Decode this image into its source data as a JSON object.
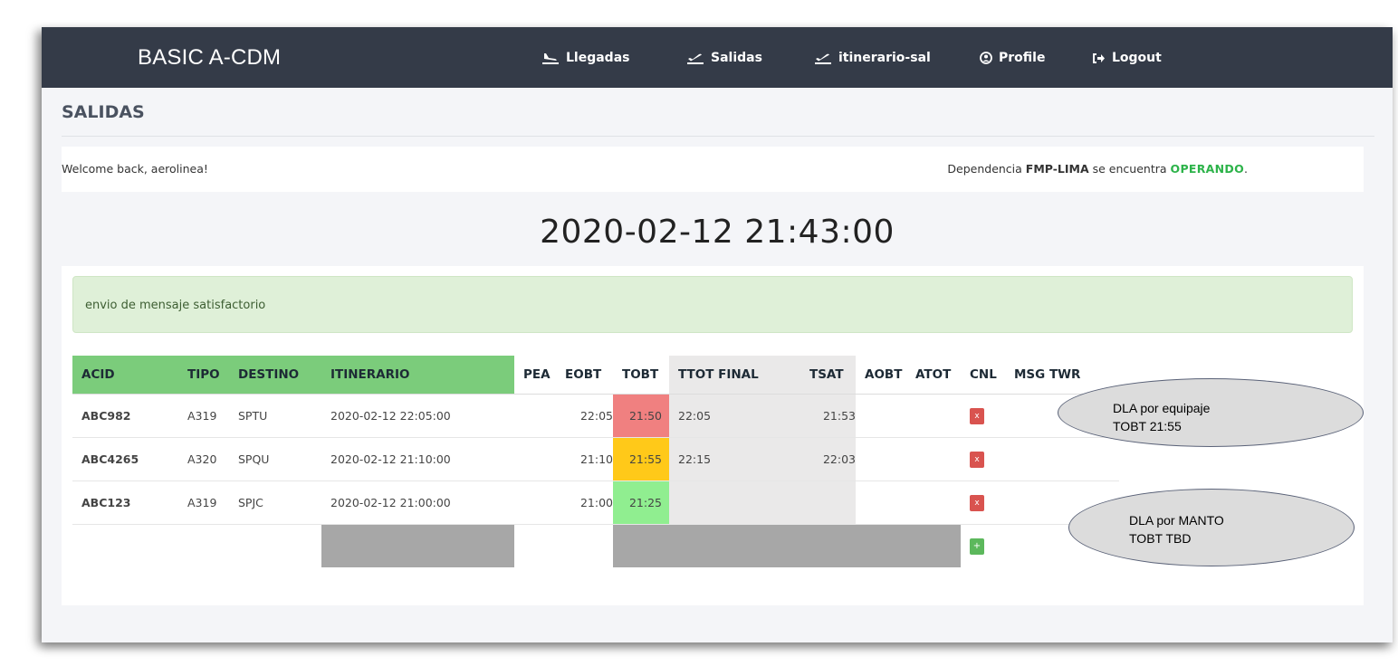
{
  "navbar": {
    "brand": "BASIC A-CDM",
    "items": [
      {
        "label": "Llegadas",
        "icon": "plane-arrival-icon"
      },
      {
        "label": "Salidas",
        "icon": "plane-departure-icon"
      },
      {
        "label": "itinerario-sal",
        "icon": "plane-departure-icon"
      },
      {
        "label": "Profile",
        "icon": "user-circle-icon"
      },
      {
        "label": "Logout",
        "icon": "sign-out-icon"
      }
    ]
  },
  "page": {
    "title": "SALIDAS",
    "welcome": "Welcome back, aerolinea!",
    "dependency_prefix": "Dependencia",
    "dependency_name": "FMP-LIMA",
    "dependency_middle": "se encuentra",
    "dependency_status": "OPERANDO",
    "dependency_suffix": ".",
    "clock": "2020-02-12 21:43:00",
    "alert": "envio de mensaje satisfactorio"
  },
  "table": {
    "headers": {
      "acid": "ACID",
      "tipo": "TIPO",
      "destino": "DESTINO",
      "itinerario": "ITINERARIO",
      "pea": "PEA",
      "eobt": "EOBT",
      "tobt": "TOBT",
      "ttot": "TTOT FINAL",
      "tsat": "TSAT",
      "aobt": "AOBT",
      "atot": "ATOT",
      "cnl": "CNL",
      "msg": "MSG TWR"
    },
    "rows": [
      {
        "acid": "ABC982",
        "tipo": "A319",
        "destino": "SPTU",
        "itinerario": "2020-02-12 22:05:00",
        "pea": "",
        "eobt": "22:05",
        "tobt": "21:50",
        "tobt_status": "red",
        "ttot": "22:05",
        "tsat": "21:53",
        "aobt": "",
        "atot": "",
        "cnl": "x"
      },
      {
        "acid": "ABC4265",
        "tipo": "A320",
        "destino": "SPQU",
        "itinerario": "2020-02-12 21:10:00",
        "pea": "",
        "eobt": "21:10",
        "tobt": "21:55",
        "tobt_status": "yellow",
        "ttot": "22:15",
        "tsat": "22:03",
        "aobt": "",
        "atot": "",
        "cnl": "x"
      },
      {
        "acid": "ABC123",
        "tipo": "A319",
        "destino": "SPJC",
        "itinerario": "2020-02-12 21:00:00",
        "pea": "",
        "eobt": "21:00",
        "tobt": "21:25",
        "tobt_status": "green",
        "ttot": "",
        "tsat": "",
        "aobt": "",
        "atot": "",
        "cnl": "x"
      }
    ],
    "add_button": "+"
  },
  "colors": {
    "navbar": "#343b48",
    "header_green": "#7bcc7b",
    "tobt_red": "#f08080",
    "tobt_yellow": "#ffc919",
    "tobt_green": "#90ee90",
    "operando": "#2db34a"
  },
  "callouts": [
    {
      "line1": "DLA  por equipaje",
      "line2": "TOBT 21:55"
    },
    {
      "line1": "DLA por MANTO",
      "line2": "TOBT TBD"
    }
  ]
}
